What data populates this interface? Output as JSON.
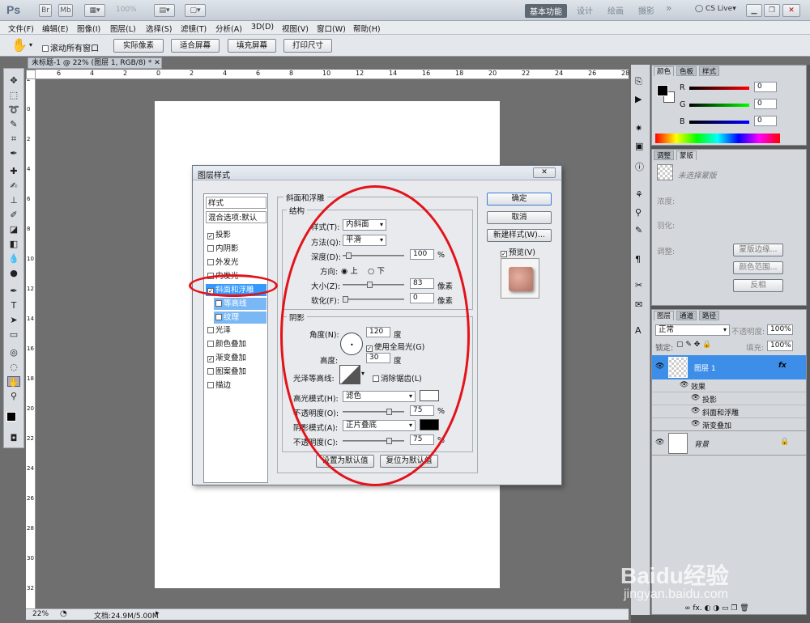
{
  "app": {
    "logo": "Ps",
    "zoom": "100%",
    "workspaces": [
      "基本功能",
      "设计",
      "绘画",
      "摄影"
    ],
    "more": "»",
    "cslive": "CS Live"
  },
  "menu": [
    "文件(F)",
    "编辑(E)",
    "图像(I)",
    "图层(L)",
    "选择(S)",
    "滤镜(T)",
    "分析(A)",
    "3D(D)",
    "视图(V)",
    "窗口(W)",
    "帮助(H)"
  ],
  "options": {
    "scroll_all": "滚动所有窗口",
    "buttons": [
      "实际像素",
      "适合屏幕",
      "填充屏幕",
      "打印尺寸"
    ]
  },
  "doc": {
    "tab": "未标题-1 @ 22% (图层 1, RGB/8) *",
    "ruler_ticks": [
      "6",
      "4",
      "2",
      "0",
      "2",
      "4",
      "6",
      "8",
      "10",
      "12",
      "14",
      "16",
      "18",
      "20",
      "22",
      "24",
      "26",
      "28"
    ],
    "vruler_ticks": [
      "2",
      "0",
      "2",
      "4",
      "6",
      "8",
      "10",
      "12",
      "14",
      "16",
      "18",
      "20",
      "22",
      "24",
      "26",
      "28",
      "30",
      "32"
    ]
  },
  "status": {
    "zoom": "22%",
    "doc": "文档:24.9M/5.00M"
  },
  "dialog": {
    "title": "图层样式",
    "styles_header": "样式",
    "blend_options": "混合选项:默认",
    "items": [
      {
        "label": "投影",
        "checked": true
      },
      {
        "label": "内阴影",
        "checked": false
      },
      {
        "label": "外发光",
        "checked": false
      },
      {
        "label": "内发光",
        "checked": false
      },
      {
        "label": "斜面和浮雕",
        "checked": true
      },
      {
        "label": "等高线",
        "checked": false
      },
      {
        "label": "纹理",
        "checked": false
      },
      {
        "label": "光泽",
        "checked": false
      },
      {
        "label": "颜色叠加",
        "checked": false
      },
      {
        "label": "渐变叠加",
        "checked": true
      },
      {
        "label": "图案叠加",
        "checked": false
      },
      {
        "label": "描边",
        "checked": false
      }
    ],
    "section": "斜面和浮雕",
    "structure": {
      "title": "结构",
      "style_label": "样式(T):",
      "style_value": "内斜面",
      "method_label": "方法(Q):",
      "method_value": "平滑",
      "depth_label": "深度(D):",
      "depth_value": "100",
      "pct": "%",
      "direction_label": "方向:",
      "up": "上",
      "down": "下",
      "size_label": "大小(Z):",
      "size_value": "83",
      "px": "像素",
      "soften_label": "软化(F):",
      "soften_value": "0"
    },
    "shading": {
      "title": "阴影",
      "angle_label": "角度(N):",
      "angle_value": "120",
      "deg": "度",
      "global_light": "使用全局光(G)",
      "altitude_label": "高度:",
      "altitude_value": "30",
      "gloss_label": "光泽等高线:",
      "anti_alias": "消除锯齿(L)",
      "highlight_label": "高光模式(H):",
      "highlight_mode": "滤色",
      "opacity_label": "不透明度(O):",
      "opacity1": "75",
      "shadow_label": "阴影模式(A):",
      "shadow_mode": "正片叠底",
      "opacity2_label": "不透明度(C):",
      "opacity2": "75",
      "highlight_color": "#ffffff",
      "shadow_color": "#000000"
    },
    "btn_default": "设置为默认值",
    "btn_reset": "复位为默认值",
    "ok": "确定",
    "cancel": "取消",
    "new_style": "新建样式(W)...",
    "preview": "预览(V)"
  },
  "panels": {
    "color": {
      "tabs": [
        "颜色",
        "色板",
        "样式"
      ],
      "r": "R",
      "g": "G",
      "b": "B",
      "values": [
        "0",
        "0",
        "0"
      ]
    },
    "adjust": {
      "tabs": [
        "调整",
        "蒙版"
      ],
      "no_mask": "未选择蒙版",
      "density": "浓度:",
      "feather": "羽化:",
      "refine": "调整:",
      "btns": [
        "蒙版边缘...",
        "颜色范围...",
        "反相"
      ]
    },
    "layers": {
      "tabs": [
        "图层",
        "通道",
        "路径"
      ],
      "blend": "正常",
      "opacity_label": "不透明度:",
      "opacity": "100%",
      "lock": "锁定:",
      "fill_label": "填充:",
      "fill": "100%",
      "layer1": "图层 1",
      "fx": "fx",
      "effects": "效果",
      "eff": [
        "投影",
        "斜面和浮雕",
        "渐变叠加"
      ],
      "bg": "背景"
    }
  },
  "watermark": {
    "text": "Baidu经验",
    "url": "jingyan.baidu.com"
  }
}
